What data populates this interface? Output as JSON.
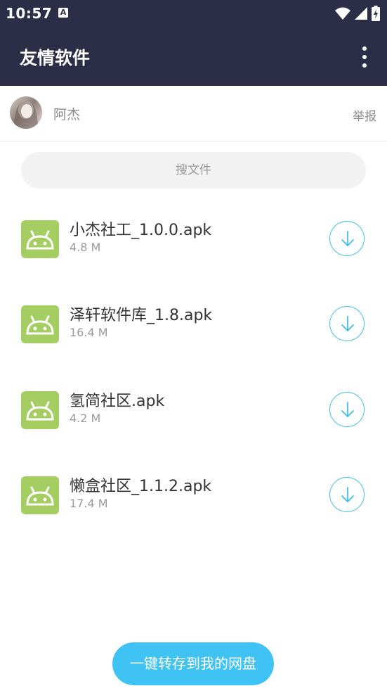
{
  "status_bar": {
    "time": "10:57",
    "notification_icon": "A"
  },
  "app_bar": {
    "title": "友情软件"
  },
  "user": {
    "name": "阿杰",
    "report_label": "举报"
  },
  "search": {
    "placeholder": "搜文件"
  },
  "files": [
    {
      "name": "小杰社工_1.0.0.apk",
      "size": "4.8 M"
    },
    {
      "name": "泽轩软件库_1.8.apk",
      "size": "16.4 M"
    },
    {
      "name": "氢简社区.apk",
      "size": "4.2 M"
    },
    {
      "name": "懒盒社区_1.1.2.apk",
      "size": "17.4 M"
    }
  ],
  "footer": {
    "save_label": "一键转存到我的网盘"
  },
  "colors": {
    "topbar": "#2c2e47",
    "apk_icon": "#a4cd62",
    "accent": "#3fc3f5",
    "download_ring": "#3cc0ea"
  },
  "icons": {
    "wifi": "wifi-icon",
    "signal": "signal-icon",
    "battery": "battery-icon",
    "menu": "more-vert-icon",
    "apk": "android-icon",
    "download": "download-arrow-icon"
  }
}
